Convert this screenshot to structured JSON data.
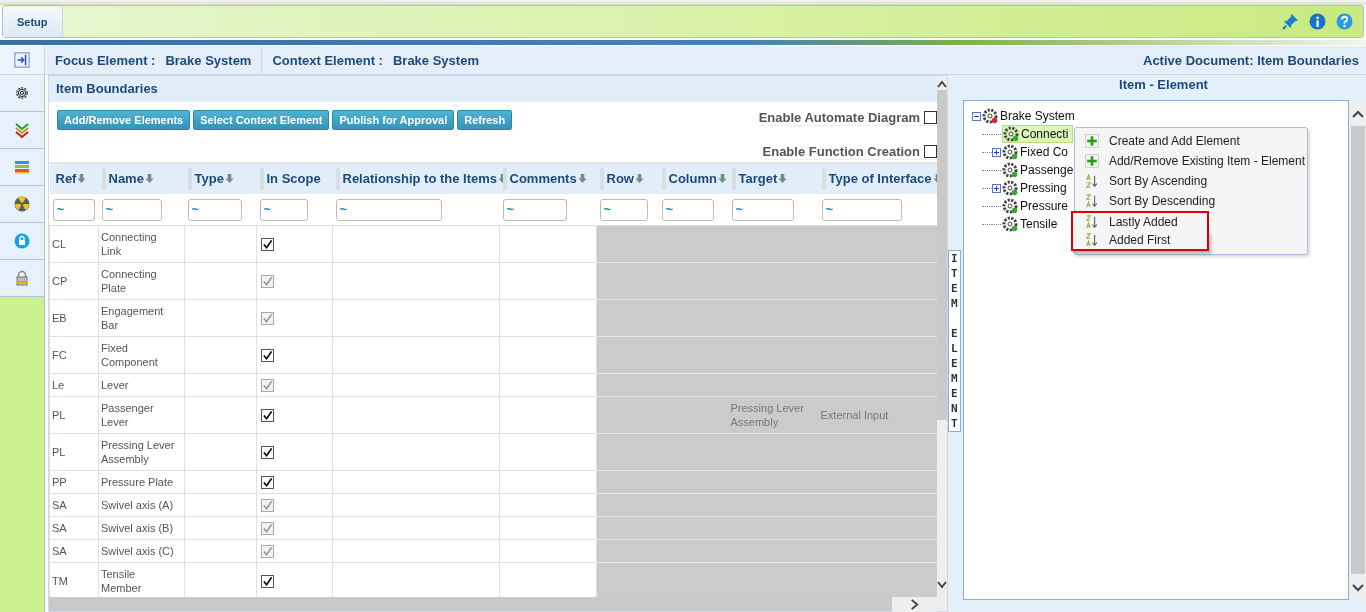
{
  "ribbon": {
    "tabs": [
      {
        "label": "Setup",
        "selected": true
      }
    ]
  },
  "info_bar": {
    "focus_label": "Focus Element :",
    "focus_value": "Brake System",
    "context_label": "Context Element :",
    "context_value": "Brake System",
    "active_document": "Active Document: Item Boundaries"
  },
  "panel": {
    "title": "Item Boundaries",
    "buttons": [
      "Add/Remove Elements",
      "Select Context Element",
      "Publish for Approval",
      "Refresh"
    ],
    "options": [
      {
        "label": "Enable Automate Diagram",
        "checked": false
      },
      {
        "label": "Enable Function Creation",
        "checked": false
      }
    ],
    "table": {
      "columns": [
        {
          "label": "Ref",
          "sortable": true
        },
        {
          "label": "Name",
          "sortable": true
        },
        {
          "label": "Type",
          "sortable": true
        },
        {
          "label": "In Scope",
          "sortable": false
        },
        {
          "label": "Relationship to the Items",
          "sortable": true
        },
        {
          "label": "Comments",
          "sortable": true
        },
        {
          "label": "Row",
          "sortable": true
        },
        {
          "label": "Column",
          "sortable": true
        },
        {
          "label": "Target",
          "sortable": true
        },
        {
          "label": "Type of Interface",
          "sortable": true
        }
      ],
      "filters": [
        "~",
        "~",
        "~",
        "~",
        "~",
        "~",
        "~",
        "~",
        "~",
        "~"
      ],
      "rows": [
        {
          "ref": "CL",
          "name": "Connecting Link",
          "in_scope": true,
          "disabled": false
        },
        {
          "ref": "CP",
          "name": "Connecting Plate",
          "in_scope": true,
          "disabled": true
        },
        {
          "ref": "EB",
          "name": "Engagement Bar",
          "in_scope": true,
          "disabled": true
        },
        {
          "ref": "FC",
          "name": "Fixed Component",
          "in_scope": true,
          "disabled": false
        },
        {
          "ref": "Le",
          "name": "Lever",
          "in_scope": true,
          "disabled": true
        },
        {
          "ref": "PL",
          "name": "Passenger Lever",
          "in_scope": true,
          "disabled": false,
          "target": "Pressing Lever Assembly",
          "type_of_interface": "External Input"
        },
        {
          "ref": "PL",
          "name": "Pressing Lever Assembly",
          "in_scope": true,
          "disabled": false
        },
        {
          "ref": "PP",
          "name": "Pressure Plate",
          "in_scope": true,
          "disabled": false
        },
        {
          "ref": "SA",
          "name": "Swivel axis (A)",
          "in_scope": true,
          "disabled": true
        },
        {
          "ref": "SA",
          "name": "Swivel axis (B)",
          "in_scope": true,
          "disabled": true
        },
        {
          "ref": "SA",
          "name": "Swivel axis (C)",
          "in_scope": true,
          "disabled": true
        },
        {
          "ref": "TM",
          "name": "Tensile Member",
          "in_scope": true,
          "disabled": false
        }
      ]
    }
  },
  "side_tab": "ITEM  ELEMENT",
  "tree": {
    "title": "Item - Element",
    "root": {
      "label": "Brake System",
      "expanded": true,
      "children": [
        {
          "label": "Connecti",
          "selected": true,
          "has_children": false
        },
        {
          "label": "Fixed Co",
          "selected": false,
          "has_children": true
        },
        {
          "label": "Passenge",
          "selected": false,
          "has_children": false
        },
        {
          "label": "Pressing",
          "selected": false,
          "has_children": true
        },
        {
          "label": "Pressure",
          "selected": false,
          "has_children": false
        },
        {
          "label": "Tensile",
          "selected": false,
          "has_children": false
        }
      ]
    }
  },
  "context_menu": {
    "items": [
      {
        "label": "Create and Add Element",
        "kind": "add",
        "highlighted": false
      },
      {
        "label": "Add/Remove Existing Item - Element",
        "kind": "add",
        "highlighted": false
      },
      {
        "label": "Sort By Ascending",
        "kind": "sort_asc",
        "highlighted": false
      },
      {
        "label": "Sort By Descending",
        "kind": "sort_desc",
        "highlighted": false
      },
      {
        "label": "Lastly Added",
        "kind": "sort_desc",
        "highlighted": true
      },
      {
        "label": "Added First",
        "kind": "sort_desc",
        "highlighted": true
      }
    ]
  }
}
